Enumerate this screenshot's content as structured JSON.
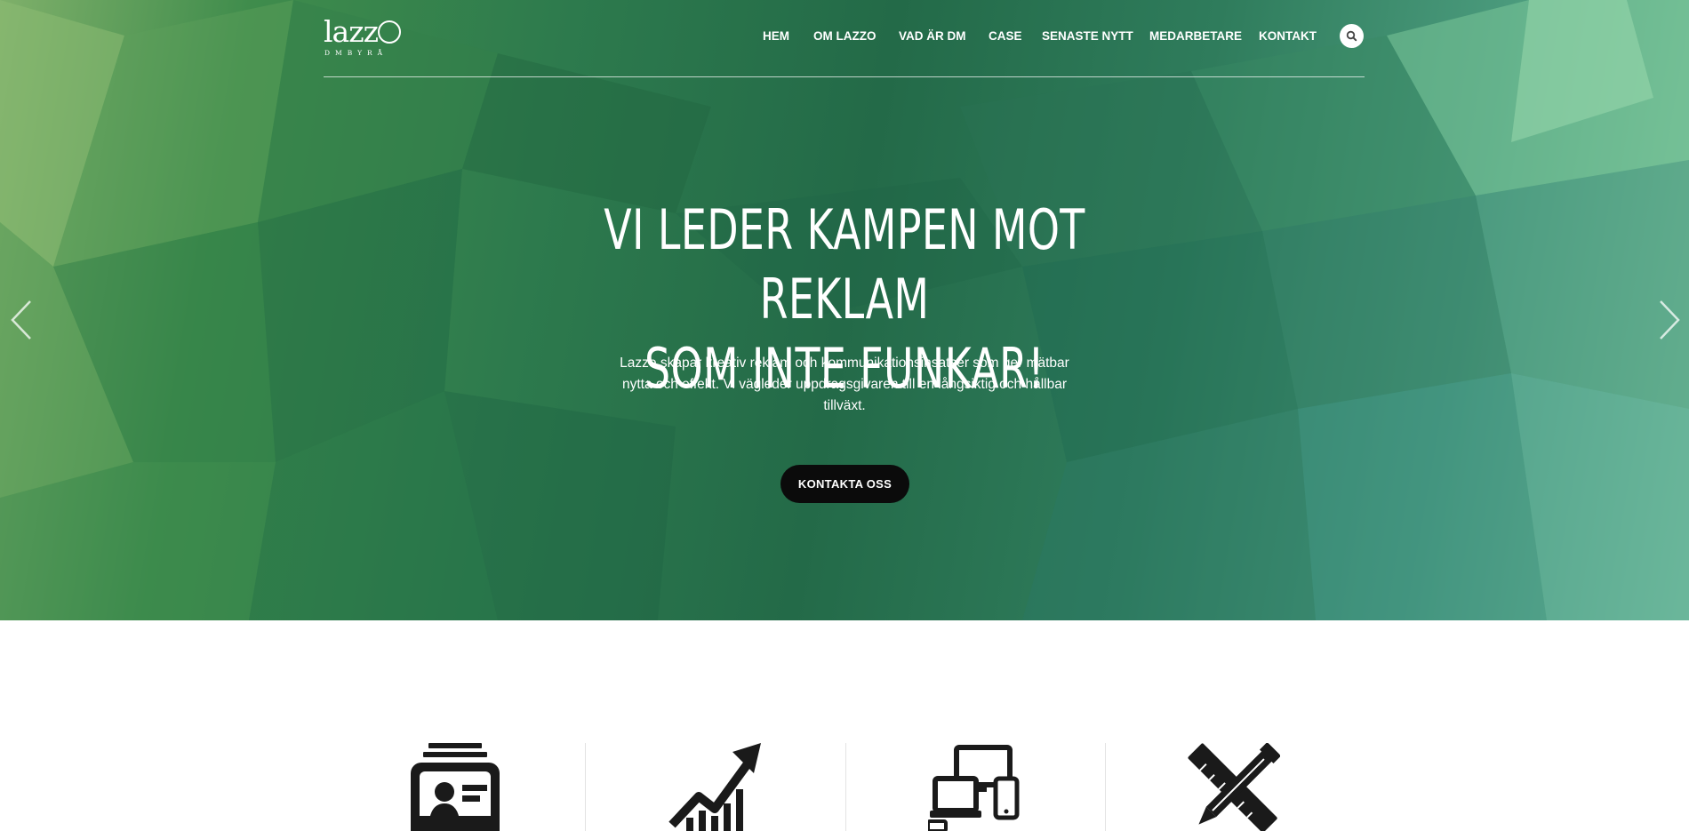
{
  "brand": {
    "logo_word": "lazz",
    "logo_sub": "DMBYRÅ"
  },
  "nav": {
    "items": [
      "HEM",
      "OM LAZZO",
      "VAD ÄR DM",
      "CASE",
      "SENASTE NYTT",
      "MEDARBETARE",
      "KONTAKT"
    ]
  },
  "icons": {
    "search": "search-icon",
    "prev": "chevron-left-icon",
    "next": "chevron-right-icon",
    "services": [
      "direct-mail-icon",
      "growth-chart-icon",
      "devices-icon",
      "design-tools-icon"
    ]
  },
  "hero": {
    "headline_line1": "VI LEDER KAMPEN MOT REKLAM",
    "headline_line2": "SOM INTE FUNKAR!",
    "lead": "Lazzo skapar kreativ reklam och kommunikationsinsatser som ger mätbar nytta och effekt. Vi vägleder uppdragsgivaren till en långsiktig och hållbar tillväxt.",
    "cta_label": "KONTAKTA OSS"
  },
  "colors": {
    "hero_green": "#236a48",
    "cta_bg": "#0b0b0b",
    "text_light": "#ffffff"
  }
}
